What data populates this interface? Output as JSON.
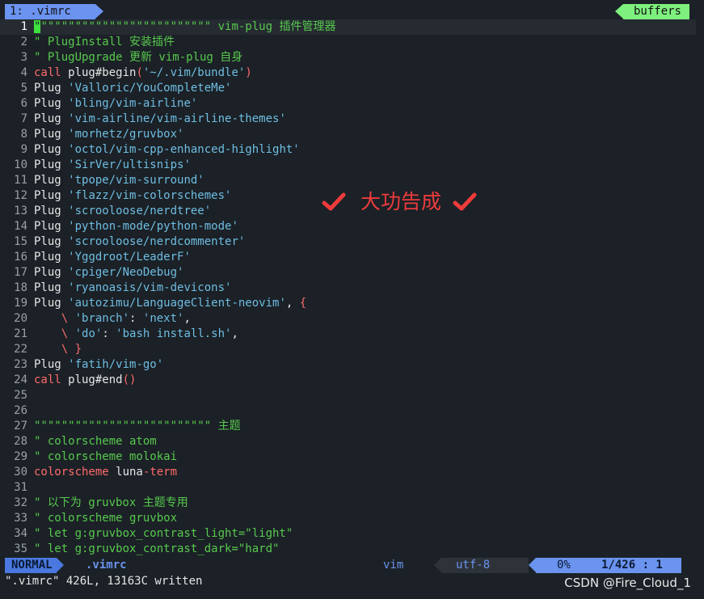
{
  "tabline": {
    "active_tab": "1: .vimrc",
    "buffers_label": "buffers"
  },
  "editor": {
    "lines": [
      {
        "n": "1",
        "current": true,
        "segs": [
          {
            "t": "\"",
            "c": "cursor"
          },
          {
            "t": "\"\"\"\"\"\"\"\"\"\"\"\"\"\"\"\"\"\"\"\"\"\"\"\"\" vim-plug 插件管理器",
            "c": "comment"
          }
        ]
      },
      {
        "n": "2",
        "segs": [
          {
            "t": "\" PlugInstall 安装插件",
            "c": "comment"
          }
        ]
      },
      {
        "n": "3",
        "segs": [
          {
            "t": "\" PlugUpgrade 更新 vim-plug 自身",
            "c": "comment"
          }
        ]
      },
      {
        "n": "4",
        "segs": [
          {
            "t": "call",
            "c": "keyword"
          },
          {
            "t": " plug#begin",
            "c": "plain"
          },
          {
            "t": "(",
            "c": "keyword"
          },
          {
            "t": "'~/.vim/bundle'",
            "c": "string"
          },
          {
            "t": ")",
            "c": "keyword"
          }
        ]
      },
      {
        "n": "5",
        "segs": [
          {
            "t": "Plug ",
            "c": "plain"
          },
          {
            "t": "'Valloric/YouCompleteMe'",
            "c": "string"
          }
        ]
      },
      {
        "n": "6",
        "segs": [
          {
            "t": "Plug ",
            "c": "plain"
          },
          {
            "t": "'bling/vim-airline'",
            "c": "string"
          }
        ]
      },
      {
        "n": "7",
        "segs": [
          {
            "t": "Plug ",
            "c": "plain"
          },
          {
            "t": "'vim-airline/vim-airline-themes'",
            "c": "string"
          }
        ]
      },
      {
        "n": "8",
        "segs": [
          {
            "t": "Plug ",
            "c": "plain"
          },
          {
            "t": "'morhetz/gruvbox'",
            "c": "string"
          }
        ]
      },
      {
        "n": "9",
        "segs": [
          {
            "t": "Plug ",
            "c": "plain"
          },
          {
            "t": "'octol/vim-cpp-enhanced-highlight'",
            "c": "string"
          }
        ]
      },
      {
        "n": "10",
        "segs": [
          {
            "t": "Plug ",
            "c": "plain"
          },
          {
            "t": "'SirVer/ultisnips'",
            "c": "string"
          }
        ]
      },
      {
        "n": "11",
        "segs": [
          {
            "t": "Plug ",
            "c": "plain"
          },
          {
            "t": "'tpope/vim-surround'",
            "c": "string"
          }
        ]
      },
      {
        "n": "12",
        "segs": [
          {
            "t": "Plug ",
            "c": "plain"
          },
          {
            "t": "'flazz/vim-colorschemes'",
            "c": "string"
          }
        ]
      },
      {
        "n": "13",
        "segs": [
          {
            "t": "Plug ",
            "c": "plain"
          },
          {
            "t": "'scrooloose/nerdtree'",
            "c": "string"
          }
        ]
      },
      {
        "n": "14",
        "segs": [
          {
            "t": "Plug ",
            "c": "plain"
          },
          {
            "t": "'python-mode/python-mode'",
            "c": "string"
          }
        ]
      },
      {
        "n": "15",
        "segs": [
          {
            "t": "Plug ",
            "c": "plain"
          },
          {
            "t": "'scrooloose/nerdcommenter'",
            "c": "string"
          }
        ]
      },
      {
        "n": "16",
        "segs": [
          {
            "t": "Plug ",
            "c": "plain"
          },
          {
            "t": "'Yggdroot/LeaderF'",
            "c": "string"
          }
        ]
      },
      {
        "n": "17",
        "segs": [
          {
            "t": "Plug ",
            "c": "plain"
          },
          {
            "t": "'cpiger/NeoDebug'",
            "c": "string"
          }
        ]
      },
      {
        "n": "18",
        "segs": [
          {
            "t": "Plug ",
            "c": "plain"
          },
          {
            "t": "'ryanoasis/vim-devicons'",
            "c": "string"
          }
        ]
      },
      {
        "n": "19",
        "segs": [
          {
            "t": "Plug ",
            "c": "plain"
          },
          {
            "t": "'autozimu/LanguageClient-neovim'",
            "c": "string"
          },
          {
            "t": ", ",
            "c": "plain"
          },
          {
            "t": "{",
            "c": "keyword"
          }
        ]
      },
      {
        "n": "20",
        "segs": [
          {
            "t": "    ",
            "c": "plain"
          },
          {
            "t": "\\",
            "c": "keyword"
          },
          {
            "t": " ",
            "c": "plain"
          },
          {
            "t": "'branch'",
            "c": "string"
          },
          {
            "t": ": ",
            "c": "plain"
          },
          {
            "t": "'next'",
            "c": "string"
          },
          {
            "t": ",",
            "c": "plain"
          }
        ]
      },
      {
        "n": "21",
        "segs": [
          {
            "t": "    ",
            "c": "plain"
          },
          {
            "t": "\\",
            "c": "keyword"
          },
          {
            "t": " ",
            "c": "plain"
          },
          {
            "t": "'do'",
            "c": "string"
          },
          {
            "t": ": ",
            "c": "plain"
          },
          {
            "t": "'bash install.sh'",
            "c": "string"
          },
          {
            "t": ",",
            "c": "plain"
          }
        ]
      },
      {
        "n": "22",
        "segs": [
          {
            "t": "    ",
            "c": "plain"
          },
          {
            "t": "\\ }",
            "c": "keyword"
          }
        ]
      },
      {
        "n": "23",
        "segs": [
          {
            "t": "Plug ",
            "c": "plain"
          },
          {
            "t": "'fatih/vim-go'",
            "c": "string"
          }
        ]
      },
      {
        "n": "24",
        "segs": [
          {
            "t": "call",
            "c": "keyword"
          },
          {
            "t": " plug#end",
            "c": "plain"
          },
          {
            "t": "()",
            "c": "keyword"
          }
        ]
      },
      {
        "n": "25",
        "segs": []
      },
      {
        "n": "26",
        "segs": []
      },
      {
        "n": "27",
        "segs": [
          {
            "t": "\"\"\"\"\"\"\"\"\"\"\"\"\"\"\"\"\"\"\"\"\"\"\"\"\"\" 主题",
            "c": "comment"
          }
        ]
      },
      {
        "n": "28",
        "segs": [
          {
            "t": "\" colorscheme atom",
            "c": "comment"
          }
        ]
      },
      {
        "n": "29",
        "segs": [
          {
            "t": "\" colorscheme molokai",
            "c": "comment"
          }
        ]
      },
      {
        "n": "30",
        "segs": [
          {
            "t": "colorscheme",
            "c": "keyword"
          },
          {
            "t": " luna",
            "c": "plain"
          },
          {
            "t": "-term",
            "c": "keyword"
          }
        ]
      },
      {
        "n": "31",
        "segs": []
      },
      {
        "n": "32",
        "segs": [
          {
            "t": "\" 以下为 gruvbox 主题专用",
            "c": "comment"
          }
        ]
      },
      {
        "n": "33",
        "segs": [
          {
            "t": "\" colorscheme gruvbox",
            "c": "comment"
          }
        ]
      },
      {
        "n": "34",
        "segs": [
          {
            "t": "\" let g:gruvbox_contrast_light=\"light\"",
            "c": "comment"
          }
        ]
      },
      {
        "n": "35",
        "segs": [
          {
            "t": "\" let g:gruvbox_contrast_dark=\"hard\"",
            "c": "comment"
          }
        ]
      }
    ]
  },
  "statusline": {
    "mode": "NORMAL",
    "filename": ".vimrc",
    "filetype": "vim",
    "encoding": "utf-8",
    "percent": "0%",
    "position": "1/426 :  1"
  },
  "cmdline": {
    "message": "\".vimrc\" 426L, 13163C written"
  },
  "overlay": {
    "text": "大功告成",
    "color": "#ee3b3b",
    "icon": "checkmark-icon"
  },
  "watermark": {
    "text": "CSDN @Fire_Cloud_1"
  },
  "colors": {
    "background": "#1b2126",
    "comment": "#58c94f",
    "keyword": "#ff6b6b",
    "string": "#6fbde3",
    "tab_accent": "#6b93f0",
    "buffers_accent": "#7ef07e"
  }
}
